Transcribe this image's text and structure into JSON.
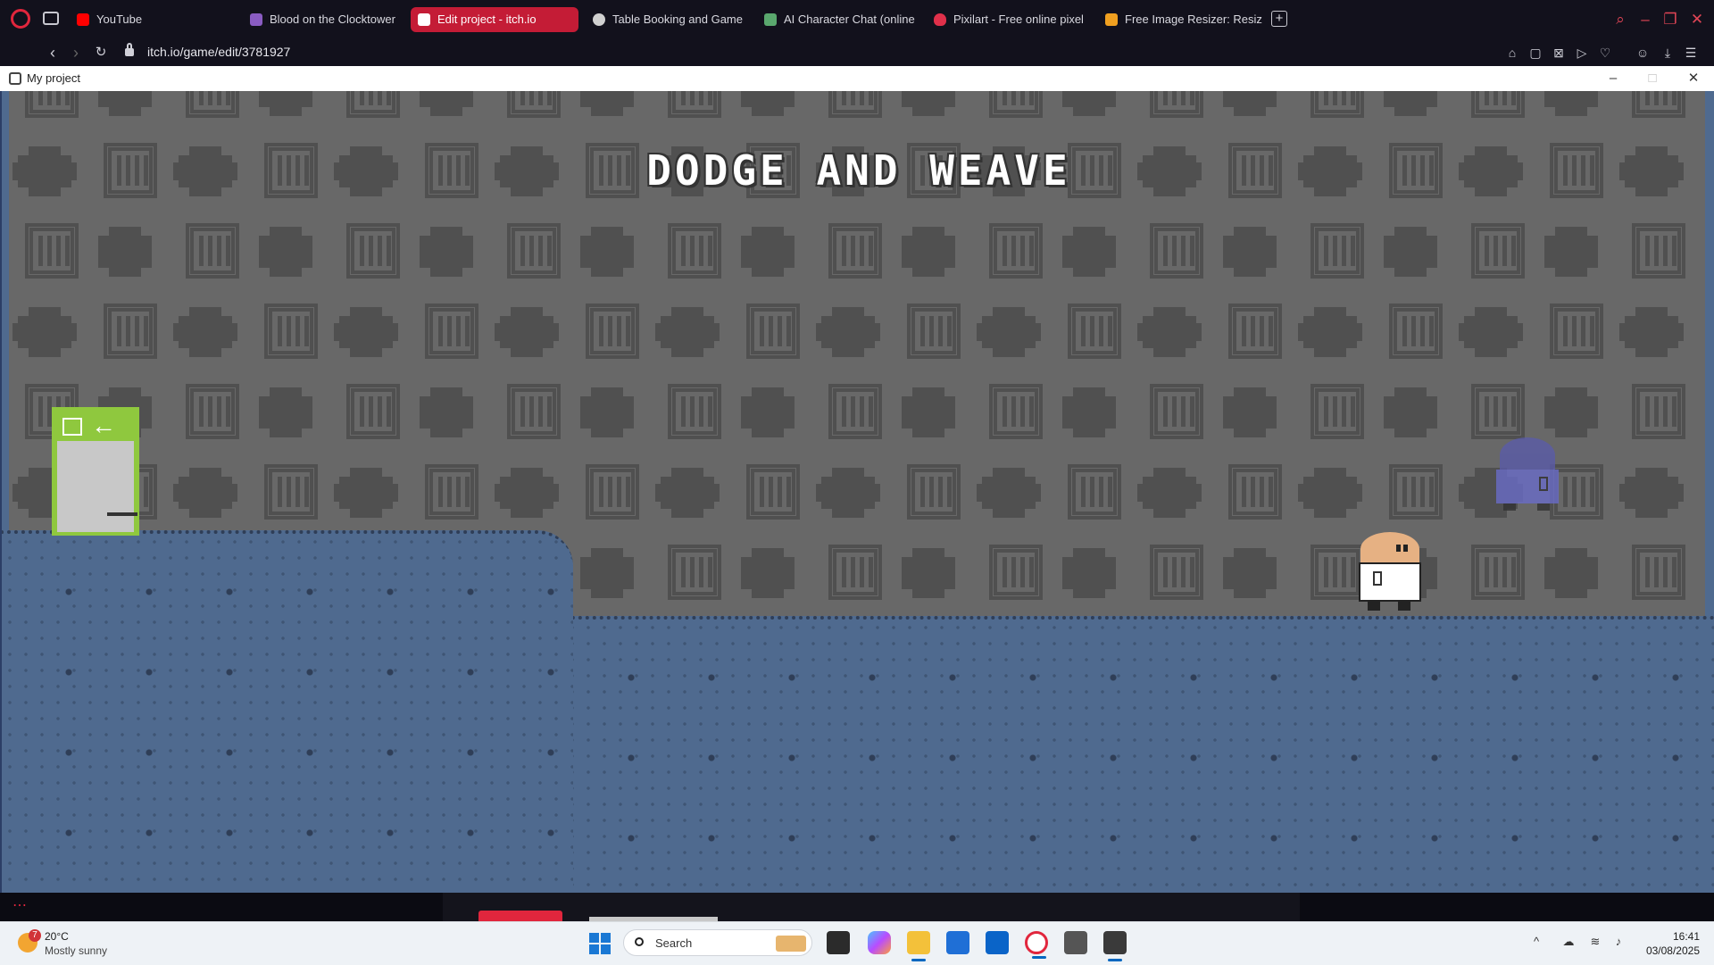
{
  "browser": {
    "tabs": [
      {
        "label": "YouTube",
        "color": "#ff0000",
        "icon": "youtube-icon"
      },
      {
        "label": "Blood on the Clocktower",
        "color": "#8a5cc2",
        "icon": "clocktower-icon"
      },
      {
        "label": "Edit project - itch.io",
        "color": "#ffffff",
        "icon": "itchio-icon"
      },
      {
        "label": "Table Booking and Game",
        "color": "#d0d0d0",
        "icon": "globe-icon"
      },
      {
        "label": "AI Character Chat (online",
        "color": "#5aa86e",
        "icon": "character-icon"
      },
      {
        "label": "Pixilart - Free online pixel",
        "color": "#e0304a",
        "icon": "heart-icon"
      },
      {
        "label": "Free Image Resizer: Resiz",
        "color": "#f0a020",
        "icon": "resizer-icon"
      }
    ],
    "url": "itch.io/game/edit/3781927"
  },
  "window": {
    "title": "My project"
  },
  "game": {
    "title": "DODGE AND WEAVE"
  },
  "taskbar": {
    "weather": {
      "badge": "7",
      "temp": "20°C",
      "desc": "Mostly sunny"
    },
    "search_label": "Search",
    "clock": {
      "time": "16:41",
      "date": "03/08/2025"
    }
  },
  "colors": {
    "accent": "#c41c36",
    "wall": "#686868",
    "floor": "#4f6a8f",
    "exit": "#8fc83e"
  }
}
